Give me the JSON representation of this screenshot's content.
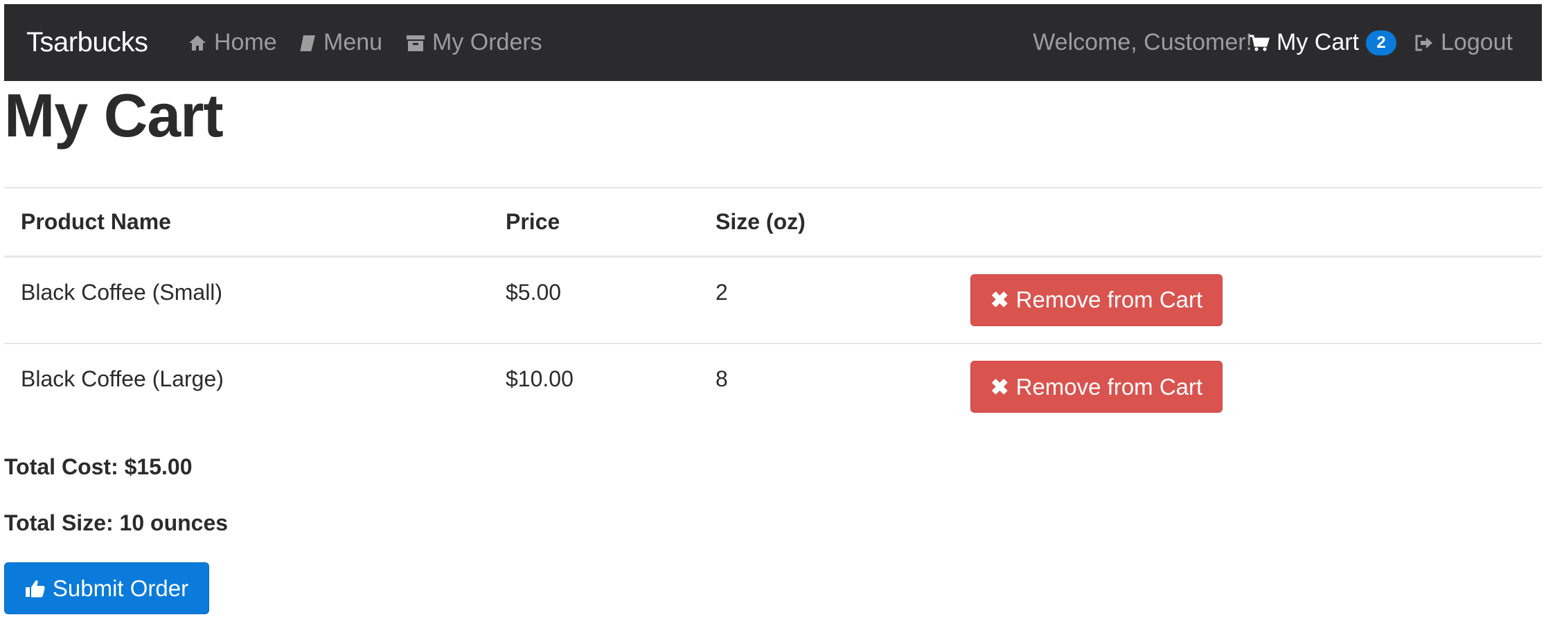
{
  "navbar": {
    "brand": "Tsarbucks",
    "links": {
      "home": "Home",
      "menu": "Menu",
      "orders": "My Orders",
      "cart": "My Cart",
      "logout": "Logout"
    },
    "welcome": "Welcome, Customer!",
    "cart_count": "2",
    "icons": {
      "home": "home-icon",
      "menu": "book-icon",
      "orders": "archive-box-icon",
      "cart": "shopping-cart-icon",
      "logout": "logout-icon"
    },
    "colors": {
      "background": "#2b2b2e",
      "link": "#9d9d9d",
      "active": "#ffffff",
      "badge": "#0a7bdb"
    }
  },
  "page_title": "My Cart",
  "table": {
    "headers": [
      "Product Name",
      "Price",
      "Size (oz)",
      ""
    ],
    "rows": [
      {
        "name": "Black Coffee (Small)",
        "price": "$5.00",
        "size": "2",
        "action": "Remove from Cart"
      },
      {
        "name": "Black Coffee (Large)",
        "price": "$10.00",
        "size": "8",
        "action": "Remove from Cart"
      }
    ]
  },
  "totals": {
    "cost": "Total Cost: $15.00",
    "size": "Total Size: 10 ounces"
  },
  "submit_label": "Submit Order",
  "colors": {
    "remove_button": "#d9534f",
    "submit_button": "#0a7bdb"
  }
}
